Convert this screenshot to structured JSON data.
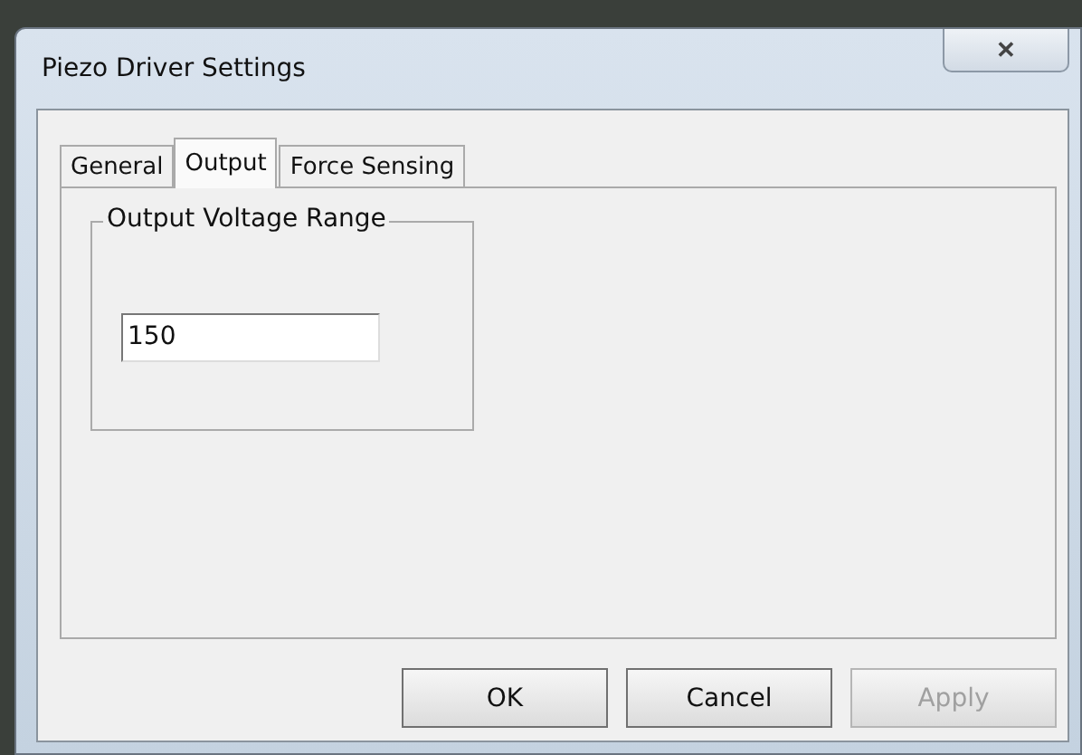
{
  "window": {
    "title": "Piezo Driver Settings",
    "close": "✕"
  },
  "tabs": [
    {
      "label": "General",
      "selected": false
    },
    {
      "label": "Output",
      "selected": true
    },
    {
      "label": "Force Sensing",
      "selected": false
    }
  ],
  "group": {
    "title": "Output Voltage Range",
    "field": {
      "value": "150"
    }
  },
  "buttons": [
    {
      "label": "OK",
      "disabled": false
    },
    {
      "label": "Cancel",
      "disabled": false
    },
    {
      "label": "Apply",
      "disabled": true
    }
  ]
}
